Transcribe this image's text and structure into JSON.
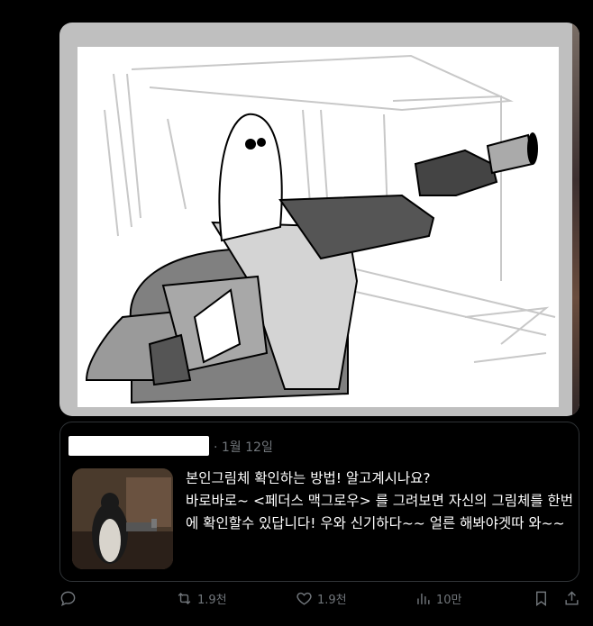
{
  "quote": {
    "date": "· 1월 12일",
    "text": "본인그림체 확인하는 방법! 알고계시나요?\n바로바로~ <페더스 맥그로우> 를 그려보면 자신의 그림체를 한번에 확인할수 있답니다! 우와 신기하다~~ 얼른 해봐야겟따 와~~"
  },
  "actions": {
    "reply_icon": "reply-icon",
    "retweet_count": "1.9천",
    "like_count": "1.9천",
    "views_count": "10만",
    "bookmark_icon": "bookmark-icon",
    "share_icon": "share-icon"
  },
  "colors": {
    "background": "#000000",
    "muted": "#71767b",
    "border": "#2f3336"
  }
}
